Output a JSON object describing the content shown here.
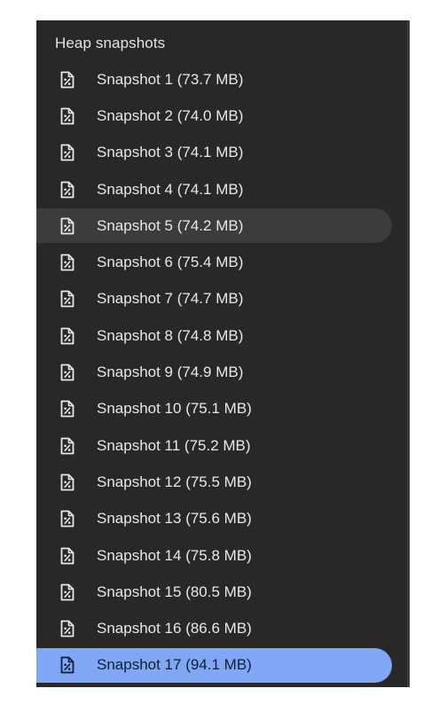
{
  "panel": {
    "header": "Heap snapshots",
    "icon": "snapshot-file-icon",
    "items": [
      {
        "label": "Snapshot 1 (73.7 MB)"
      },
      {
        "label": "Snapshot 2 (74.0 MB)"
      },
      {
        "label": "Snapshot 3 (74.1 MB)"
      },
      {
        "label": "Snapshot 4 (74.1 MB)"
      },
      {
        "label": "Snapshot 5 (74.2 MB)",
        "state": "hover"
      },
      {
        "label": "Snapshot 6 (75.4 MB)"
      },
      {
        "label": "Snapshot 7 (74.7 MB)"
      },
      {
        "label": "Snapshot 8 (74.8 MB)"
      },
      {
        "label": "Snapshot 9 (74.9 MB)"
      },
      {
        "label": "Snapshot 10 (75.1 MB)"
      },
      {
        "label": "Snapshot 11 (75.2 MB)"
      },
      {
        "label": "Snapshot 12 (75.5 MB)"
      },
      {
        "label": "Snapshot 13 (75.6 MB)"
      },
      {
        "label": "Snapshot 14 (75.8 MB)"
      },
      {
        "label": "Snapshot 15 (80.5 MB)"
      },
      {
        "label": "Snapshot 16 (86.6 MB)"
      },
      {
        "label": "Snapshot 17 (94.1 MB)",
        "state": "selected"
      }
    ]
  },
  "colors": {
    "panel_background": "#282828",
    "hover_background": "#3c3c3c",
    "selected_background": "#7fa7f5",
    "text": "#e8e8e8",
    "selected_text": "#0f1d36"
  }
}
